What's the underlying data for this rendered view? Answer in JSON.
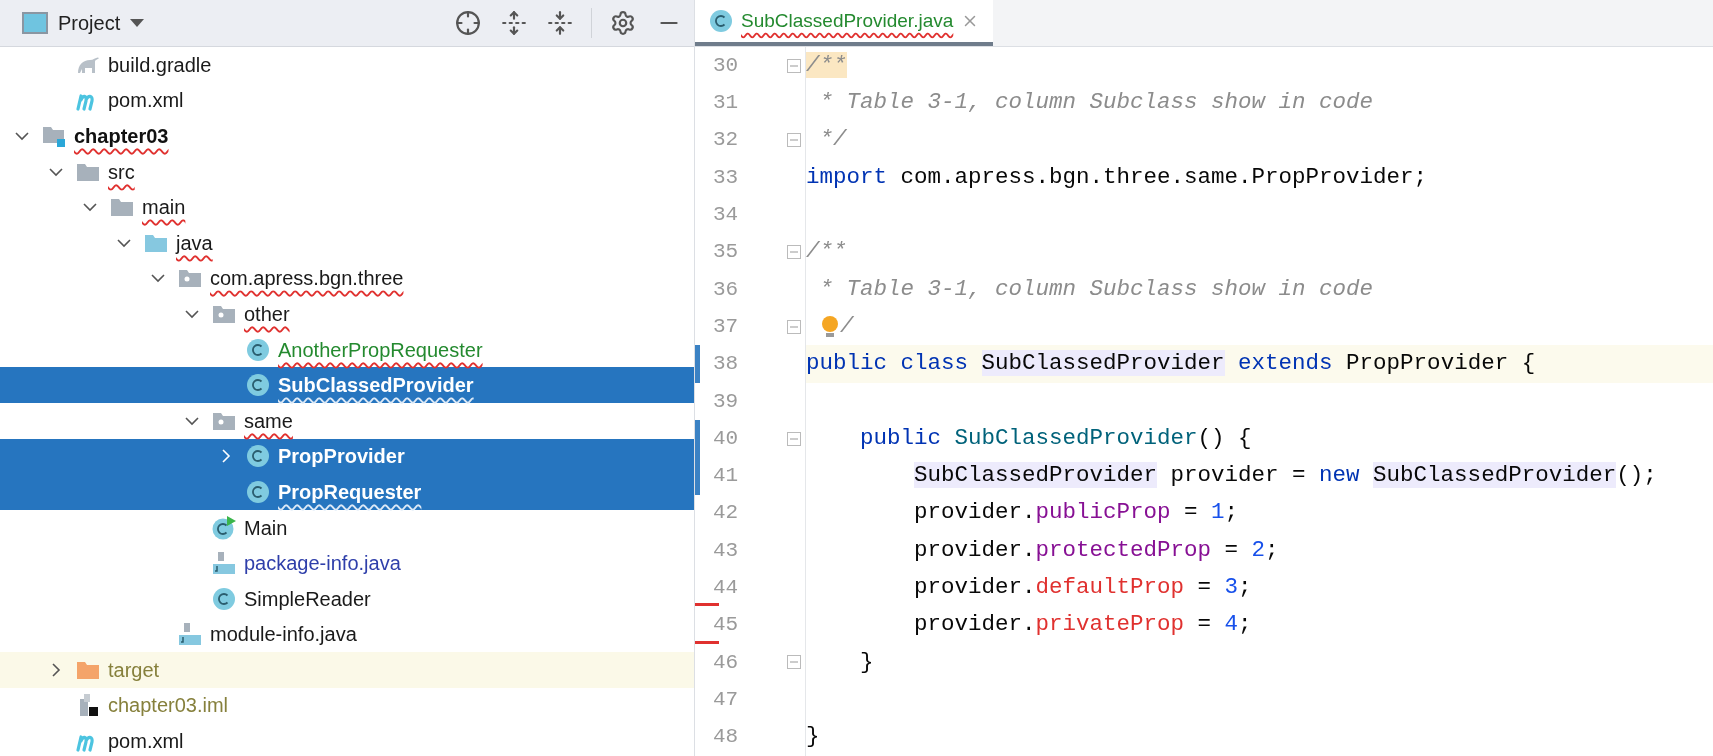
{
  "project_panel": {
    "title": "Project"
  },
  "tree": [
    {
      "children": [
        {
          "name": "build.gradle",
          "kind": "gradle",
          "color": "#1a1a1a",
          "bold": false,
          "error": false,
          "selected": false
        },
        {
          "name": "pom.xml",
          "kind": "maven",
          "color": "#1a1a1a",
          "bold": false,
          "error": false,
          "selected": false
        }
      ]
    },
    {
      "name": "chapter03",
      "kind": "module",
      "color": "#111111",
      "bold": true,
      "error": true,
      "selected": false,
      "expanded": true,
      "children": [
        {
          "name": "src",
          "kind": "folder",
          "color": "#1a1a1a",
          "bold": false,
          "error": true,
          "selected": false,
          "expanded": true,
          "children": [
            {
              "name": "main",
              "kind": "folder",
              "color": "#1a1a1a",
              "bold": false,
              "error": true,
              "selected": false,
              "expanded": true,
              "children": [
                {
                  "name": "java",
                  "kind": "source",
                  "color": "#1a1a1a",
                  "bold": false,
                  "error": true,
                  "selected": false,
                  "expanded": true,
                  "children": [
                    {
                      "name": "com.apress.bgn.three",
                      "kind": "package",
                      "color": "#1a1a1a",
                      "bold": false,
                      "error": true,
                      "selected": false,
                      "expanded": true,
                      "children": [
                        {
                          "name": "other",
                          "kind": "package",
                          "color": "#1a1a1a",
                          "bold": false,
                          "error": true,
                          "selected": false,
                          "expanded": true,
                          "children": [
                            {
                              "name": "AnotherPropRequester",
                              "kind": "class",
                              "color": "#248a2f",
                              "bold": false,
                              "error": true,
                              "selected": false
                            },
                            {
                              "name": "SubClassedProvider",
                              "kind": "class",
                              "color": "#ffffff",
                              "bold": true,
                              "error": true,
                              "selected": true
                            }
                          ]
                        },
                        {
                          "name": "same",
                          "kind": "package",
                          "color": "#1a1a1a",
                          "bold": false,
                          "error": true,
                          "selected": false,
                          "expanded": true,
                          "children": [
                            {
                              "name": "PropProvider",
                              "kind": "class",
                              "color": "#ffffff",
                              "bold": true,
                              "error": false,
                              "selected": true,
                              "expanded": false
                            },
                            {
                              "name": "PropRequester",
                              "kind": "class",
                              "color": "#ffffff",
                              "bold": true,
                              "error": true,
                              "selected": true
                            }
                          ]
                        },
                        {
                          "name": "Main",
                          "kind": "main-class",
                          "color": "#1a1a1a",
                          "bold": false,
                          "error": false,
                          "selected": false
                        },
                        {
                          "name": "package-info.java",
                          "kind": "java-file",
                          "color": "#2f3faa",
                          "bold": false,
                          "error": false,
                          "selected": false
                        },
                        {
                          "name": "SimpleReader",
                          "kind": "class",
                          "color": "#1a1a1a",
                          "bold": false,
                          "error": false,
                          "selected": false
                        }
                      ]
                    },
                    {
                      "name": "module-info.java",
                      "kind": "java-file",
                      "color": "#1a1a1a",
                      "bold": false,
                      "error": false,
                      "selected": false
                    }
                  ]
                }
              ]
            }
          ]
        },
        {
          "name": "target",
          "kind": "excluded",
          "color": "#86803c",
          "bold": false,
          "error": false,
          "selected": false,
          "expanded": false
        },
        {
          "name": "chapter03.iml",
          "kind": "iml",
          "color": "#86803c",
          "bold": false,
          "error": false,
          "selected": false
        },
        {
          "name": "pom.xml",
          "kind": "maven",
          "color": "#1a1a1a",
          "bold": false,
          "error": false,
          "selected": false
        }
      ]
    }
  ],
  "editor_tab": {
    "label": "SubClassedProvider.java",
    "color": "#248a2f",
    "error": true,
    "selected": true
  },
  "code_lines": [
    {
      "number": "30",
      "fold": true,
      "bulb": false,
      "current": false,
      "modified": false,
      "deleted": false,
      "in_block": false,
      "tokens": [
        {
          "kind": "match",
          "text": "/**"
        }
      ]
    },
    {
      "number": "31",
      "fold": false,
      "bulb": false,
      "current": false,
      "modified": false,
      "deleted": false,
      "in_block": false,
      "tokens": [
        {
          "kind": "comment",
          "text": " * Table 3-1, column Subclass show in code"
        }
      ]
    },
    {
      "number": "32",
      "fold": true,
      "bulb": false,
      "current": false,
      "modified": false,
      "deleted": false,
      "in_block": false,
      "tokens": [
        {
          "kind": "comment",
          "text": " */"
        }
      ]
    },
    {
      "number": "33",
      "fold": false,
      "bulb": false,
      "current": false,
      "modified": false,
      "deleted": false,
      "in_block": false,
      "tokens": [
        {
          "kind": "keyword",
          "text": "import"
        },
        {
          "kind": "plain",
          "text": " com.apress.bgn.three.same.PropProvider;"
        }
      ]
    },
    {
      "number": "34",
      "fold": false,
      "bulb": false,
      "current": false,
      "modified": false,
      "deleted": false
    },
    {
      "number": "35",
      "fold": true,
      "bulb": false,
      "current": false,
      "modified": false,
      "deleted": false,
      "in_block": false,
      "tokens": [
        {
          "kind": "comment",
          "text": "/**"
        }
      ]
    },
    {
      "number": "36",
      "fold": false,
      "bulb": false,
      "current": false,
      "modified": false,
      "deleted": false,
      "in_block": false,
      "tokens": [
        {
          "kind": "comment",
          "text": " * Table 3-1, column Subclass show in code"
        }
      ]
    },
    {
      "number": "37",
      "fold": true,
      "bulb": true,
      "current": false,
      "modified": false,
      "deleted": false,
      "in_block": false,
      "tokens": [
        {
          "kind": "comment",
          "text": "/"
        }
      ]
    },
    {
      "number": "38",
      "fold": false,
      "bulb": false,
      "current": true,
      "modified": true,
      "deleted": false,
      "in_block": false,
      "tokens": [
        {
          "kind": "keyword",
          "text": "public class "
        },
        {
          "kind": "usage",
          "text": "SubClassedProvider"
        },
        {
          "kind": "keyword",
          "text": " extends"
        },
        {
          "kind": "plain",
          "text": " PropProvider {"
        }
      ]
    },
    {
      "number": "39",
      "fold": false,
      "bulb": false,
      "current": false,
      "modified": false,
      "deleted": false
    },
    {
      "number": "40",
      "fold": true,
      "bulb": false,
      "current": false,
      "modified": true,
      "deleted": false,
      "in_block": false,
      "tokens": [
        {
          "kind": "keyword",
          "text": "    public "
        },
        {
          "kind": "method",
          "text": "SubClassedProvider"
        },
        {
          "kind": "plain",
          "text": "() {"
        }
      ]
    },
    {
      "number": "41",
      "fold": false,
      "bulb": false,
      "current": false,
      "modified": true,
      "deleted": false,
      "in_block": true,
      "tokens": [
        {
          "kind": "usage",
          "text": "SubClassedProvider"
        },
        {
          "kind": "plain",
          "text": " provider = "
        },
        {
          "kind": "keyword",
          "text": "new "
        },
        {
          "kind": "usage",
          "text": "SubClassedProvider"
        },
        {
          "kind": "plain",
          "text": "();"
        }
      ]
    },
    {
      "number": "42",
      "fold": false,
      "bulb": false,
      "current": false,
      "modified": false,
      "deleted": false,
      "in_block": true,
      "tokens": [
        {
          "kind": "plain",
          "text": "provider."
        },
        {
          "kind": "field",
          "text": "publicProp"
        },
        {
          "kind": "plain",
          "text": " = "
        },
        {
          "kind": "number",
          "text": "1"
        },
        {
          "kind": "plain",
          "text": ";"
        }
      ]
    },
    {
      "number": "43",
      "fold": false,
      "bulb": false,
      "current": false,
      "modified": false,
      "deleted": false,
      "in_block": true,
      "tokens": [
        {
          "kind": "plain",
          "text": "provider."
        },
        {
          "kind": "field",
          "text": "protectedProp"
        },
        {
          "kind": "plain",
          "text": " = "
        },
        {
          "kind": "number",
          "text": "2"
        },
        {
          "kind": "plain",
          "text": ";"
        }
      ]
    },
    {
      "number": "44",
      "fold": false,
      "bulb": false,
      "current": false,
      "modified": false,
      "deleted": true,
      "in_block": true,
      "tokens": [
        {
          "kind": "plain",
          "text": "provider."
        },
        {
          "kind": "error",
          "text": "defaultProp"
        },
        {
          "kind": "plain",
          "text": " = "
        },
        {
          "kind": "number",
          "text": "3"
        },
        {
          "kind": "plain",
          "text": ";"
        }
      ]
    },
    {
      "number": "45",
      "fold": false,
      "bulb": false,
      "current": false,
      "modified": false,
      "deleted": true,
      "in_block": true,
      "tokens": [
        {
          "kind": "plain",
          "text": "provider."
        },
        {
          "kind": "error",
          "text": "privateProp"
        },
        {
          "kind": "plain",
          "text": " = "
        },
        {
          "kind": "number",
          "text": "4"
        },
        {
          "kind": "plain",
          "text": ";"
        }
      ]
    },
    {
      "number": "46",
      "fold": true,
      "bulb": false,
      "current": false,
      "modified": false,
      "deleted": false,
      "in_block": false,
      "tokens": [
        {
          "kind": "plain",
          "text": "    }"
        }
      ]
    },
    {
      "number": "47",
      "fold": false,
      "bulb": false,
      "current": false,
      "modified": false,
      "deleted": false
    },
    {
      "number": "48",
      "fold": false,
      "bulb": false,
      "current": false,
      "modified": false,
      "deleted": false,
      "in_block": false,
      "tokens": [
        {
          "kind": "plain",
          "text": "}"
        }
      ]
    }
  ]
}
